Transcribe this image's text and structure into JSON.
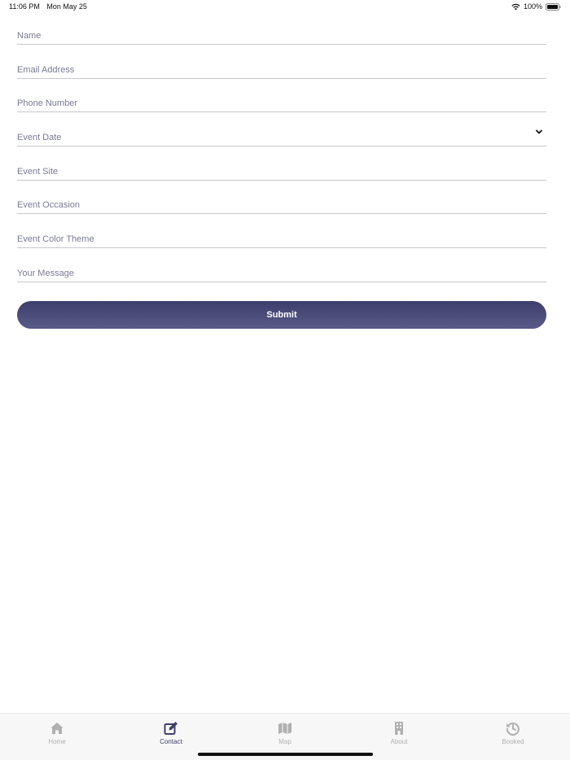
{
  "status_bar": {
    "time": "11:06 PM",
    "date": "Mon May 25",
    "battery": "100%"
  },
  "form": {
    "fields": [
      {
        "placeholder": "Name"
      },
      {
        "placeholder": "Email Address"
      },
      {
        "placeholder": "Phone Number"
      },
      {
        "placeholder": "Event Date"
      },
      {
        "placeholder": "Event Site"
      },
      {
        "placeholder": "Event Occasion"
      },
      {
        "placeholder": "Event Color Theme"
      },
      {
        "placeholder": "Your Message"
      }
    ],
    "submit_label": "Submit"
  },
  "tabs": [
    {
      "label": "Home",
      "icon": "home-icon"
    },
    {
      "label": "Contact",
      "icon": "edit-icon"
    },
    {
      "label": "Map",
      "icon": "map-icon"
    },
    {
      "label": "About",
      "icon": "building-icon"
    },
    {
      "label": "Booked",
      "icon": "history-icon"
    }
  ],
  "colors": {
    "accent": "#3e3e6c",
    "inactive_tab": "#b0b0b0",
    "placeholder": "#7a7a96"
  }
}
